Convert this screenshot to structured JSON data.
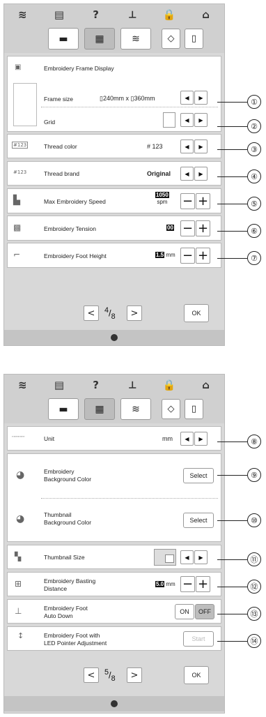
{
  "topbar": {
    "icons": [
      "wifi-icon",
      "page-icon",
      "help-icon",
      "needle-icon",
      "lock-icon",
      "home-icon"
    ],
    "glyphs": [
      "≋",
      "▤",
      "?",
      "⟂",
      "🔒",
      "⌂"
    ]
  },
  "tabs": {
    "glyphs": [
      "▬",
      "▦",
      "≋",
      "◇",
      "▯"
    ]
  },
  "screen1": {
    "frame_display": {
      "label": "Embroidery Frame Display"
    },
    "frame_size": {
      "label": "Frame size",
      "w": "240mm",
      "x": "x",
      "h": "360mm"
    },
    "grid": {
      "label": "Grid"
    },
    "thread_color": {
      "label": "Thread color",
      "value": "# 123",
      "icon_text": "#123"
    },
    "thread_brand": {
      "label": "Thread brand",
      "value": "Original",
      "icon_text": "#123"
    },
    "max_speed": {
      "label": "Max Embroidery Speed",
      "value": "1050",
      "unit": "spm"
    },
    "tension": {
      "label": "Embroidery Tension",
      "value": "00"
    },
    "foot_height": {
      "label": "Embroidery Foot Height",
      "value": "1.5",
      "unit": "mm"
    },
    "page": {
      "current": "4",
      "total": "8",
      "ok": "OK"
    }
  },
  "screen2": {
    "unit": {
      "label": "Unit",
      "value": "mm"
    },
    "bg_color": {
      "label1": "Embroidery",
      "label2": "Background Color",
      "button": "Select"
    },
    "thumb_bg_color": {
      "label1": "Thumbnail",
      "label2": "Background Color",
      "button": "Select"
    },
    "thumb_size": {
      "label": "Thumbnail Size"
    },
    "basting": {
      "label1": "Embroidery Basting",
      "label2": "Distance",
      "value": "5.0",
      "unit": "mm"
    },
    "auto_down": {
      "label1": "Embroidery Foot",
      "label2": "Auto Down",
      "on": "ON",
      "off": "OFF"
    },
    "led_pointer": {
      "label1": "Embroidery Foot with",
      "label2": "LED Pointer Adjustment",
      "button": "Start"
    },
    "page": {
      "current": "5",
      "total": "8",
      "ok": "OK"
    }
  },
  "common": {
    "left": "◀",
    "right": "▶",
    "minus": "−",
    "plus": "+",
    "prev": "<",
    "next": ">",
    "slash": "/"
  },
  "callouts": [
    "①",
    "②",
    "③",
    "④",
    "⑤",
    "⑥",
    "⑦",
    "⑧",
    "⑨",
    "⑩",
    "⑪",
    "⑫",
    "⑬",
    "⑭"
  ]
}
